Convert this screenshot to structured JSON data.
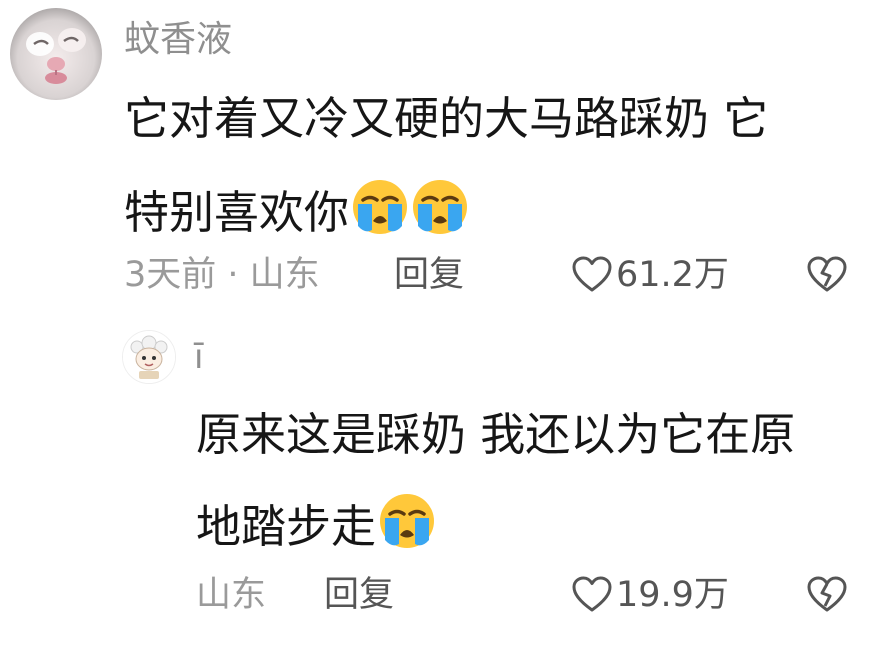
{
  "comments": [
    {
      "username": "蚊香液",
      "lines": [
        "它对着又冷又硬的大马路踩奶 它",
        "特别喜欢你"
      ],
      "emoji": [
        "loudly-crying-face",
        "loudly-crying-face"
      ],
      "meta": "3天前 · 山东",
      "reply_label": "回复",
      "like_count": "61.2万"
    },
    {
      "username": "ī",
      "lines": [
        "原来这是踩奶 我还以为它在原",
        "地踏步走"
      ],
      "emoji": [
        "loudly-crying-face"
      ],
      "meta": "山东",
      "reply_label": "回复",
      "like_count": "19.9万"
    }
  ],
  "icons": {
    "like": "heart-outline-icon",
    "dislike": "broken-heart-icon"
  },
  "colors": {
    "text": "#161616",
    "meta": "#9a9a9a",
    "action": "#555555",
    "emoji_face": "#ffc83a",
    "emoji_tears": "#3aa6f0"
  }
}
